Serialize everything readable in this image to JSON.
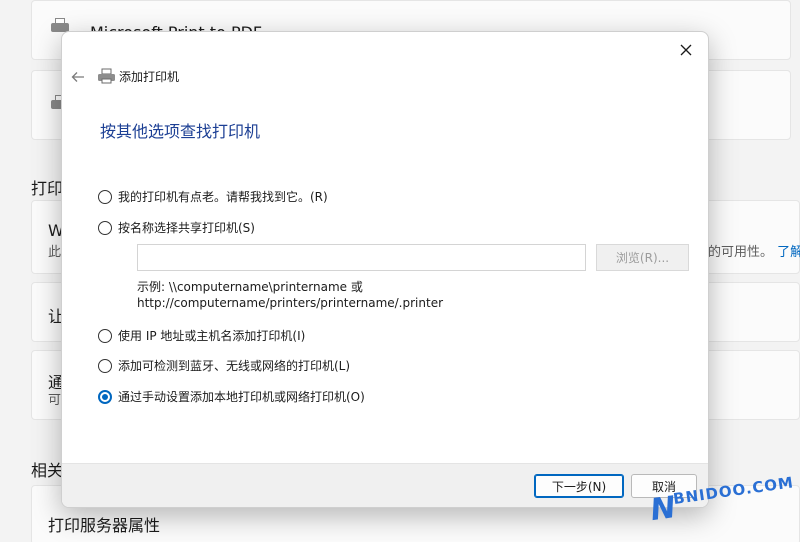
{
  "background": {
    "printer_items": [
      "Microsoft Print to PDF",
      ""
    ],
    "section_heading_1": "打印",
    "card_w_title": "W",
    "card_w_sub_left": "此",
    "card_w_sub_right": "的可用性。",
    "card_w_link": "了解",
    "card_let": "让",
    "card_tong_title": "通",
    "card_tong_sub": "可",
    "section_heading_2": "相关",
    "print_server_properties": "打印服务器属性"
  },
  "dialog": {
    "window_title": "添加打印机",
    "heading": "按其他选项查找打印机",
    "options": [
      {
        "label": "我的打印机有点老。请帮我找到它。(R)",
        "checked": false
      },
      {
        "label": "按名称选择共享打印机(S)",
        "checked": false
      },
      {
        "label": "使用 IP 地址或主机名添加打印机(I)",
        "checked": false
      },
      {
        "label": "添加可检测到蓝牙、无线或网络的打印机(L)",
        "checked": false
      },
      {
        "label": "通过手动设置添加本地打印机或网络打印机(O)",
        "checked": true
      }
    ],
    "shared_name_value": "",
    "browse_label": "浏览(R)...",
    "example_line1": "示例: \\\\computername\\printername 或",
    "example_line2": "http://computername/printers/printername/.printer",
    "next_label": "下一步(N)",
    "cancel_label": "取消"
  },
  "watermark": {
    "letter": "N",
    "text": "BNIDOO.COM"
  },
  "colors": {
    "accent": "#0067c0",
    "heading": "#1c3f94",
    "watermark": "#2a6fd4"
  },
  "icons": {
    "close": "close-icon",
    "back": "back-arrow-icon",
    "printer": "printer-icon"
  }
}
